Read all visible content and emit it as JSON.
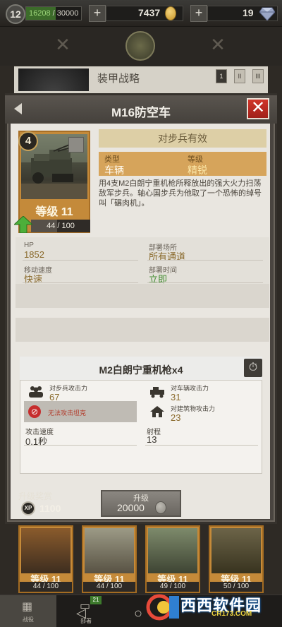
{
  "topbar": {
    "level": "12",
    "xp_current": "16208",
    "xp_max": "/ 30000",
    "xp_fraction": 0.54,
    "coins": "7437",
    "gems": "19",
    "plus": "+"
  },
  "background": {
    "deck_title": "装甲战略",
    "deck_slots": [
      "1",
      "II",
      "III"
    ]
  },
  "modal": {
    "title": "M16防空车",
    "close": "✕",
    "card": {
      "cost": "4",
      "level": "等级 11",
      "progress_text": "44 / 100",
      "progress_fraction": 0.44
    },
    "effect": "对步兵有效",
    "type_label": "类型",
    "type_value": "车辆",
    "rarity_label": "等级",
    "rarity_value": "精锐",
    "description": "用4支M2白朗宁重机枪所释放出的强大火力扫荡敌军步兵。轴心国步兵为他取了一个恐怖的绰号叫「碾肉机」。",
    "stats": {
      "hp_label": "HP",
      "hp_value": "1852",
      "deploy_label": "部署场所",
      "deploy_value": "所有通道",
      "speed_label": "移动速度",
      "speed_value": "快速",
      "deploytime_label": "部署时间",
      "deploytime_value": "立即"
    },
    "weapon": {
      "title": "M2白朗宁重机枪x4",
      "inf_label": "对步兵攻击力",
      "inf_value": "67",
      "veh_label": "对车辆攻击力",
      "veh_value": "31",
      "no_attack": "无法攻击坦克",
      "bld_label": "对建筑物攻击力",
      "bld_value": "23",
      "rate_label": "攻击速度",
      "rate_value": "0.1秒",
      "range_label": "射程",
      "range_value": "13"
    },
    "reward_label": "升级奖赏",
    "reward_xp_icon": "XP",
    "reward_value": "1100",
    "upgrade_label": "升级",
    "upgrade_cost": "20000"
  },
  "bottom_cards": [
    {
      "level": "等级 11",
      "count": "44 / 100"
    },
    {
      "level": "等级 11",
      "count": "44 / 100"
    },
    {
      "level": "等级 11",
      "count": "49 / 100"
    },
    {
      "level": "等级 11",
      "count": "50 / 100"
    }
  ],
  "nav": {
    "tab1_label": "战役",
    "tab2_label": "部署",
    "tab2_badge": "21"
  },
  "watermark": {
    "text": "西西软件园",
    "url": "CR173.COM"
  },
  "colors": {
    "accent_orange": "#c48a3a",
    "close_red": "#c62d2d",
    "xp_green": "#3c6b2a"
  }
}
